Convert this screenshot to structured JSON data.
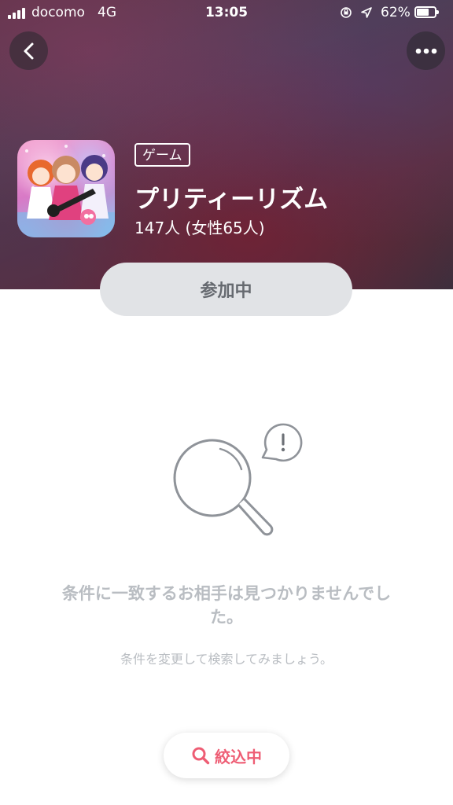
{
  "status_bar": {
    "carrier": "docomo",
    "network": "4G",
    "time": "13:05",
    "battery": "62%",
    "battery_level": 0.62,
    "signal_bars": 4
  },
  "header": {
    "category": "ゲーム",
    "title": "プリティーリズム",
    "member_count": "147人 (女性65人)"
  },
  "actions": {
    "joined_label": "参加中",
    "filter_label": "絞込中"
  },
  "empty_state": {
    "title": "条件に一致するお相手は見つかりませんでした。",
    "hint": "条件を変更して検索してみましょう。"
  },
  "icons": {
    "back": "chevron-left-icon",
    "more": "more-horizontal-icon",
    "search": "search-icon",
    "rotation_lock": "rotation-lock-icon",
    "location": "location-arrow-icon"
  },
  "colors": {
    "accent": "#ee5d74",
    "muted_text": "#b9bdc2",
    "joined_bg": "#e1e3e6"
  }
}
